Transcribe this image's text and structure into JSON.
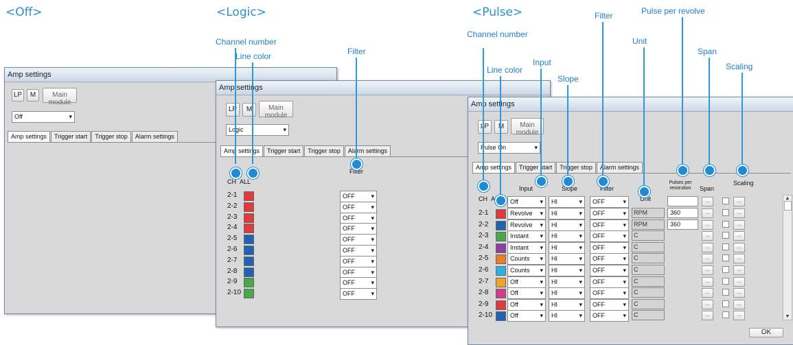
{
  "modes": {
    "off": "<Off>",
    "logic": "<Logic>",
    "pulse": "<Pulse>"
  },
  "callouts": {
    "channel_number": "Channel number",
    "line_color": "Line color",
    "filter": "Filter",
    "input": "Input",
    "slope": "Slope",
    "unit": "Unit",
    "pulse_per_revolve": "Pulse per revolve",
    "span": "Span",
    "scaling": "Scaling"
  },
  "window_title": "Amp settings",
  "buttons": {
    "lp": "LP",
    "m": "M",
    "main_module": "Main module",
    "ok": "OK",
    "ellipsis": "..."
  },
  "tabs": [
    "Amp settings",
    "Trigger start",
    "Trigger stop",
    "Alarm settings"
  ],
  "off_window": {
    "mode_select": "Off"
  },
  "logic_window": {
    "mode_select": "Logic",
    "headers": {
      "ch": "CH",
      "all": "ALL",
      "filter": "Filter"
    },
    "rows": [
      {
        "ch": "2-1",
        "color": "#e03a3e",
        "filter": "OFF"
      },
      {
        "ch": "2-2",
        "color": "#e03a3e",
        "filter": "OFF"
      },
      {
        "ch": "2-3",
        "color": "#e03a3e",
        "filter": "OFF"
      },
      {
        "ch": "2-4",
        "color": "#e03a3e",
        "filter": "OFF"
      },
      {
        "ch": "2-5",
        "color": "#2163b0",
        "filter": "OFF"
      },
      {
        "ch": "2-6",
        "color": "#2163b0",
        "filter": "OFF"
      },
      {
        "ch": "2-7",
        "color": "#2163b0",
        "filter": "OFF"
      },
      {
        "ch": "2-8",
        "color": "#2163b0",
        "filter": "OFF"
      },
      {
        "ch": "2-9",
        "color": "#4aa84a",
        "filter": "OFF"
      },
      {
        "ch": "2-10",
        "color": "#4aa84a",
        "filter": "OFF"
      }
    ]
  },
  "pulse_window": {
    "mode_select": "Pulse On",
    "headers": {
      "ch": "CH",
      "all": "ALL",
      "input": "Input",
      "slope": "Slope",
      "filter": "Filter",
      "unit": "Unit",
      "pulses_per_revolution": "Pulses per revorution",
      "span": "Span",
      "scaling": "Scaling"
    },
    "all_row": {
      "input": "Off",
      "slope": "HI",
      "filter": "OFF"
    },
    "rows": [
      {
        "ch": "2-1",
        "color": "#e03a3e",
        "input": "Revolve",
        "slope": "HI",
        "filter": "OFF",
        "unit": "RPM",
        "pulses": "360"
      },
      {
        "ch": "2-2",
        "color": "#2163b0",
        "input": "Revolve",
        "slope": "HI",
        "filter": "OFF",
        "unit": "RPM",
        "pulses": "360"
      },
      {
        "ch": "2-3",
        "color": "#4aa84a",
        "input": "Instant",
        "slope": "HI",
        "filter": "OFF",
        "unit": "C",
        "pulses": ""
      },
      {
        "ch": "2-4",
        "color": "#8e3da0",
        "input": "Instant",
        "slope": "HI",
        "filter": "OFF",
        "unit": "C",
        "pulses": ""
      },
      {
        "ch": "2-5",
        "color": "#e87f2a",
        "input": "Counts",
        "slope": "HI",
        "filter": "OFF",
        "unit": "C",
        "pulses": ""
      },
      {
        "ch": "2-6",
        "color": "#2fb0e0",
        "input": "Counts",
        "slope": "HI",
        "filter": "OFF",
        "unit": "C",
        "pulses": ""
      },
      {
        "ch": "2-7",
        "color": "#f0a52a",
        "input": "Off",
        "slope": "HI",
        "filter": "OFF",
        "unit": "C",
        "pulses": ""
      },
      {
        "ch": "2-8",
        "color": "#d63a8e",
        "input": "Off",
        "slope": "HI",
        "filter": "OFF",
        "unit": "C",
        "pulses": ""
      },
      {
        "ch": "2-9",
        "color": "#e03a3e",
        "input": "Off",
        "slope": "HI",
        "filter": "OFF",
        "unit": "C",
        "pulses": ""
      },
      {
        "ch": "2-10",
        "color": "#2163b0",
        "input": "Off",
        "slope": "HI",
        "filter": "OFF",
        "unit": "C",
        "pulses": ""
      }
    ]
  }
}
